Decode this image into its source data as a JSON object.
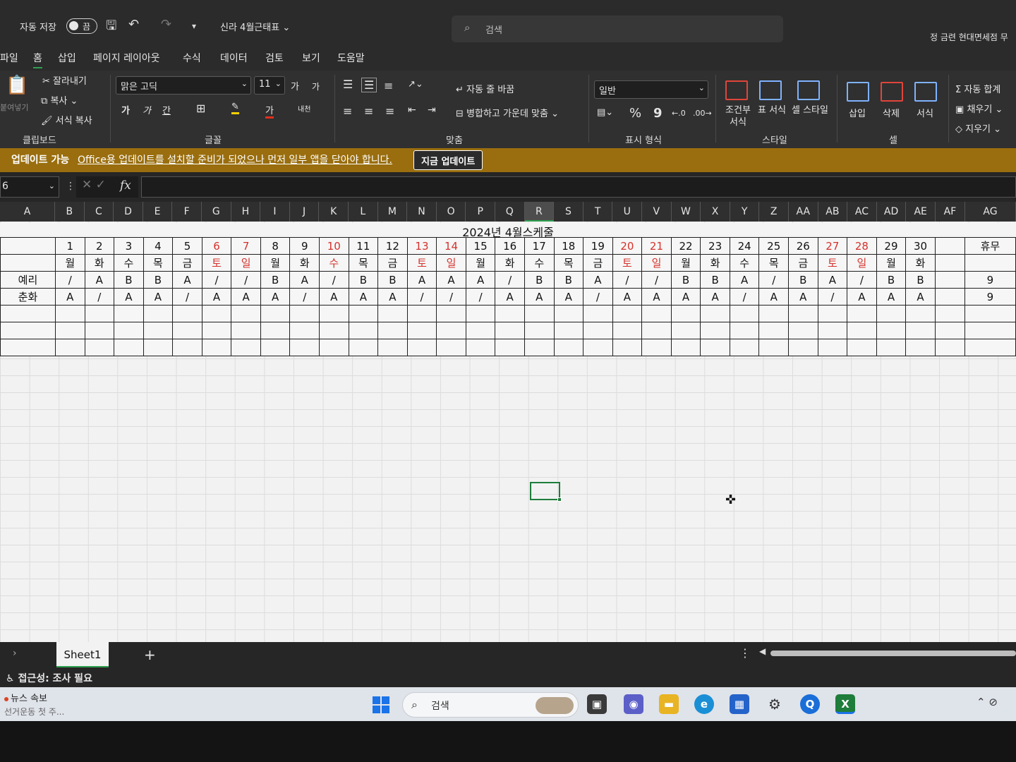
{
  "titlebar": {
    "autosave_label": "자동 저장",
    "autosave_state": "끔",
    "doc_title": "신라 4월근태표",
    "search_placeholder": "검색",
    "user": "정 금련 현대면세점 무"
  },
  "menu": {
    "tabs": [
      "파일",
      "홈",
      "삽입",
      "페이지 레이아웃",
      "수식",
      "데이터",
      "검토",
      "보기",
      "도움말"
    ],
    "active": "홈"
  },
  "ribbon": {
    "clipboard": {
      "paste": "붙여넣기",
      "cut": "잘라내기",
      "copy": "복사",
      "format_painter": "서식 복사",
      "label": "클립보드"
    },
    "font": {
      "name": "맑은 고딕",
      "size": "11",
      "grow": "가",
      "shrink": "가",
      "bold": "가",
      "italic": "가",
      "underline": "간",
      "font_color": "가",
      "phonetic": "내천",
      "label": "글꼴"
    },
    "alignment": {
      "wrap": "자동 줄 바꿈",
      "merge": "병합하고 가운데 맞춤",
      "label": "맞춤"
    },
    "number": {
      "format": "일반",
      "percent": "%",
      "comma": "9",
      "label": "표시 형식"
    },
    "styles": {
      "conditional": "조건부 서식",
      "table": "표 서식",
      "cell": "셀 스타일",
      "label": "스타일"
    },
    "cells": {
      "insert": "삽입",
      "delete": "삭제",
      "format": "서식",
      "label": "셀"
    },
    "editing": {
      "autosum": "자동 합계",
      "fill": "채우기",
      "clear": "지우기"
    }
  },
  "update_bar": {
    "title": "업데이트 가능",
    "message": "Office용 업데이트를 설치할 준비가 되었으나 먼저 일부 앱을 닫아야 합니다.",
    "button": "지금 업데이트"
  },
  "formula_bar": {
    "name_box": "6",
    "fx": "fx",
    "value": ""
  },
  "columns": [
    "A",
    "B",
    "C",
    "D",
    "E",
    "F",
    "G",
    "H",
    "I",
    "J",
    "K",
    "L",
    "M",
    "N",
    "O",
    "P",
    "Q",
    "R",
    "S",
    "T",
    "U",
    "V",
    "W",
    "X",
    "Y",
    "Z",
    "AA",
    "AB",
    "AC",
    "AD",
    "AE",
    "AF",
    "AG"
  ],
  "selected_column": "R",
  "sheet": {
    "title": "2024년  4월스케줄",
    "days": [
      "1",
      "2",
      "3",
      "4",
      "5",
      "6",
      "7",
      "8",
      "9",
      "10",
      "11",
      "12",
      "13",
      "14",
      "15",
      "16",
      "17",
      "18",
      "19",
      "20",
      "21",
      "22",
      "23",
      "24",
      "25",
      "26",
      "27",
      "28",
      "29",
      "30"
    ],
    "weekdays": [
      "월",
      "화",
      "수",
      "목",
      "금",
      "토",
      "일",
      "월",
      "화",
      "수",
      "목",
      "금",
      "토",
      "일",
      "월",
      "화",
      "수",
      "목",
      "금",
      "토",
      "일",
      "월",
      "화",
      "수",
      "목",
      "금",
      "토",
      "일",
      "월",
      "화"
    ],
    "red_days": [
      6,
      7,
      10,
      13,
      14,
      20,
      21,
      27,
      28
    ],
    "off_header": "휴무",
    "rows": [
      {
        "name": "예리",
        "shifts": [
          "/",
          "A",
          "B",
          "B",
          "A",
          "/",
          "/",
          "B",
          "A",
          "/",
          "B",
          "B",
          "A",
          "A",
          "A",
          "/",
          "B",
          "B",
          "A",
          "/",
          "/",
          "B",
          "B",
          "A",
          "/",
          "B",
          "A",
          "/",
          "B",
          "B"
        ],
        "off": "9"
      },
      {
        "name": "춘화",
        "shifts": [
          "A",
          "/",
          "A",
          "A",
          "/",
          "A",
          "A",
          "A",
          "/",
          "A",
          "A",
          "A",
          "/",
          "/",
          "/",
          "A",
          "A",
          "A",
          "/",
          "A",
          "A",
          "A",
          "A",
          "/",
          "A",
          "A",
          "/",
          "A",
          "A",
          "A"
        ],
        "off": "9"
      }
    ]
  },
  "sheet_tabs": {
    "active": "Sheet1",
    "add": "+"
  },
  "status": {
    "accessibility": "접근성: 조사 필요"
  },
  "taskbar": {
    "news_title": "뉴스 속보",
    "news_sub": "선거운동 첫 주...",
    "search": "검색"
  },
  "colors": {
    "accent": "#2ea04f",
    "weekend_red": "#d4322c",
    "update_bar": "#9a6e0e"
  }
}
